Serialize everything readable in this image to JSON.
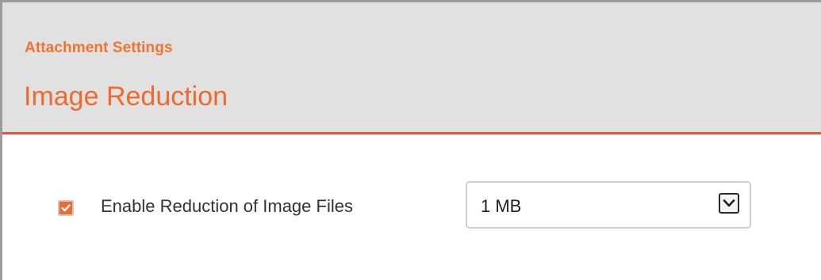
{
  "header": {
    "breadcrumb": "Attachment Settings",
    "title": "Image Reduction"
  },
  "settings": {
    "enable_reduction": {
      "label": "Enable Reduction of Image Files",
      "checked": true
    },
    "reduction_size": {
      "selected": "1 MB"
    }
  },
  "icons": {
    "checkbox_mark": "checkmark-icon",
    "dropdown": "chevron-down-icon"
  },
  "colors": {
    "accent": "#ee6a2d",
    "header_bg": "#e1e1e1",
    "divider": "#e7542f"
  }
}
